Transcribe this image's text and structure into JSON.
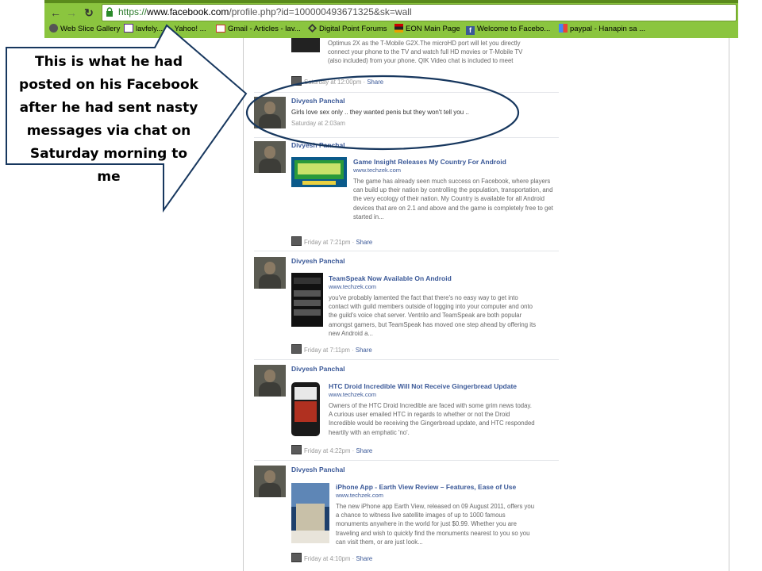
{
  "browser": {
    "url_scheme": "https://",
    "url_host": "www.facebook.com",
    "url_rest": "/profile.php?id=100000493671325&sk=wall",
    "back_glyph": "←",
    "forward_glyph": "→",
    "reload_glyph": "↻",
    "bookmarks": [
      {
        "label": "Web Slice Gallery",
        "icon": "web-slice-icon"
      },
      {
        "label": "lavfely...",
        "icon": "yahoo-mail-icon"
      },
      {
        "label": "- Yahoo! ...",
        "icon": ""
      },
      {
        "label": "Gmail - Articles - lav...",
        "icon": "gmail-icon"
      },
      {
        "label": "Digital Point Forums",
        "icon": "digital-point-icon"
      },
      {
        "label": "EON Main Page",
        "icon": "eon-icon"
      },
      {
        "label": "Welcome to Facebo...",
        "icon": "facebook-icon"
      },
      {
        "label": "paypal - Hanapin sa ...",
        "icon": "google-icon"
      }
    ]
  },
  "callout": {
    "lines": [
      "This is what he had",
      "posted on his Facebook",
      "after he had sent nasty",
      "messages via chat on",
      "Saturday  morning to",
      "me"
    ]
  },
  "feed": {
    "top_partial": {
      "text": "Optimus 2X as the T-Mobile G2X.The microHD port will let you directly connect your phone to the TV and watch full HD movies or T-Mobile TV (also included) from your phone. QIK Video chat is included to meet",
      "time": "Saturday at 12:00pm",
      "share": "Share"
    },
    "posts": [
      {
        "author": "Divyesh Panchal",
        "status": "Girls love sex only .. they wanted penis but they won't tell you ..",
        "time": "Saturday at 2:03am"
      },
      {
        "author": "Divyesh Panchal",
        "title": "Game Insight Releases My Country For Android",
        "source": "www.techzek.com",
        "desc": "The game has already seen much success on Facebook, where players can build up their nation by controlling the population, transportation, and the very ecology of their nation. My Country is available for all Android devices that are on 2.1 and above and the game is completely free to get started in...",
        "time": "Friday at 7:21pm",
        "share": "Share"
      },
      {
        "author": "Divyesh Panchal",
        "title": "TeamSpeak Now Available On Android",
        "source": "www.techzek.com",
        "desc": "you've probably lamented the fact that there's no easy way to get into contact with guild members outside of logging into your computer and onto the guild's voice chat server. Ventrilo and TeamSpeak are both popular amongst gamers, but TeamSpeak has moved one step ahead by offering its new Android a...",
        "time": "Friday at 7:11pm",
        "share": "Share"
      },
      {
        "author": "Divyesh Panchal",
        "title": "HTC Droid Incredible Will Not Receive Gingerbread Update",
        "source": "www.techzek.com",
        "desc": "Owners of the HTC Droid Incredible are faced with some grim news today. A curious user emailed HTC in regards to whether or not the Droid Incredible would be receiving the Gingerbread update, and HTC responded heartily with an emphatic 'no'.",
        "time": "Friday at 4:22pm",
        "share": "Share"
      },
      {
        "author": "Divyesh Panchal",
        "title": "iPhone App - Earth View Review – Features, Ease of Use",
        "source": "www.techzek.com",
        "desc": "The new iPhone app Earth View, released on 09 August 2011, offers you a chance to witness live satellite images of up to 1000 famous monuments anywhere in the world for just $0.99. Whether you are traveling and wish to quickly find the monuments nearest to you so you can visit them, or are just look...",
        "time": "Friday at 4:10pm",
        "share": "Share"
      }
    ],
    "separator": " · "
  }
}
